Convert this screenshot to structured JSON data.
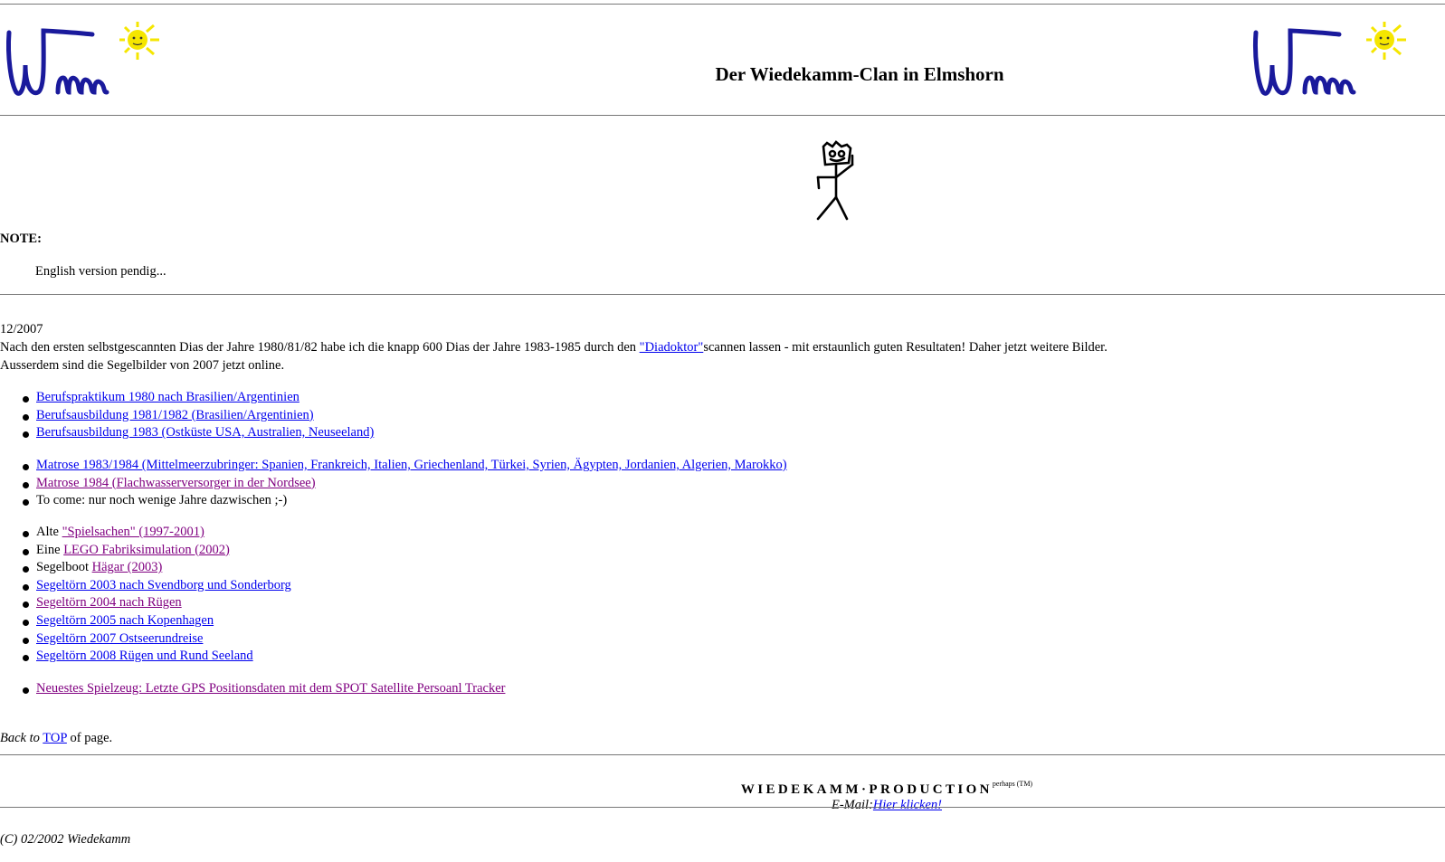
{
  "header": {
    "title": "Der Wiedekamm-Clan in Elmshorn",
    "logo_alt": "Wm logo with sun"
  },
  "note": {
    "label": "NOTE:",
    "text": "English version pendig..."
  },
  "news": {
    "date": "12/2007",
    "line1_before": "Nach den ersten selbstgescannten Dias der Jahre 1980/81/82 habe ich die knapp 600 Dias der Jahre 1983-1985 durch den ",
    "line1_link": "\"Diadoktor\"",
    "line1_after": "scannen lassen - mit erstaunlich guten Resultaten! Daher jetzt weitere Bilder.",
    "line2": "Ausserdem sind die Segelbilder von 2007 jetzt online."
  },
  "list_group1": [
    {
      "prefix": "",
      "text": "Berufspraktikum 1980 nach Brasilien/Argentinien",
      "visited": false
    },
    {
      "prefix": "",
      "text": "Berufsausbildung 1981/1982 (Brasilien/Argentinien)",
      "visited": false
    },
    {
      "prefix": "",
      "text": "Berufsausbildung 1983 (Ostküste USA, Australien, Neuseeland)",
      "visited": false
    }
  ],
  "list_group2": [
    {
      "prefix": "",
      "text": "Matrose 1983/1984 (Mittelmeerzubringer: Spanien, Frankreich, Italien, Griechenland, Türkei, Syrien, Ägypten, Jordanien, Algerien, Marokko)",
      "visited": false
    },
    {
      "prefix": "",
      "text": "Matrose 1984 (Flachwasserversorger in der Nordsee)",
      "visited": true
    },
    {
      "prefix": "To come: nur noch wenige Jahre dazwischen ;-)",
      "text": "",
      "visited": false
    }
  ],
  "list_group3": [
    {
      "prefix": "Alte ",
      "text": "\"Spielsachen\" (1997-2001)",
      "visited": true
    },
    {
      "prefix": "Eine ",
      "text": "LEGO Fabriksimulation (2002)",
      "visited": true
    },
    {
      "prefix": "Segelboot ",
      "text": "Hägar (2003)",
      "visited": true
    },
    {
      "prefix": "",
      "text": "Segeltörn 2003 nach Svendborg und Sonderborg",
      "visited": false
    },
    {
      "prefix": "",
      "text": "Segeltörn 2004 nach Rügen",
      "visited": true
    },
    {
      "prefix": "",
      "text": "Segeltörn 2005 nach Kopenhagen",
      "visited": false
    },
    {
      "prefix": "",
      "text": "Segeltörn 2007 Ostseerundreise",
      "visited": false
    },
    {
      "prefix": "",
      "text": "Segeltörn 2008 Rügen und Rund Seeland",
      "visited": false
    }
  ],
  "list_group4": [
    {
      "prefix": "",
      "text": "Neuestes Spielzeug: Letzte GPS Positionsdaten mit dem SPOT Satellite Persoanl Tracker",
      "visited": true
    }
  ],
  "back_to_top": {
    "before": "Back to",
    "link": "TOP",
    "after": "of page."
  },
  "footer": {
    "production": "WIEDEKAMM·PRODUCTION",
    "production_sup": "perhaps (TM)",
    "email_label": "E-Mail:",
    "email_link": "Hier klicken!",
    "copyright": "(C) 02/2002 Wiedekamm"
  },
  "colors": {
    "link": "#0000ee",
    "visited": "#800080",
    "logo_blue": "#1a1a9c",
    "sun_yellow": "#f5e600"
  }
}
